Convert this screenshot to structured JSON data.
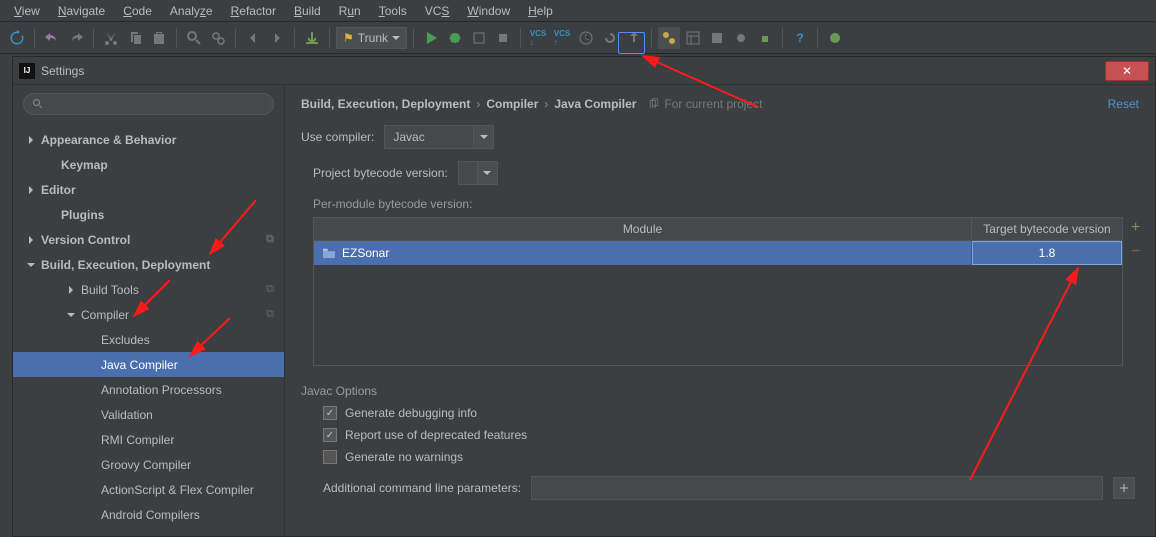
{
  "menu": [
    "View",
    "Navigate",
    "Code",
    "Analyze",
    "Refactor",
    "Build",
    "Run",
    "Tools",
    "VCS",
    "Window",
    "Help"
  ],
  "trunk_label": "Trunk",
  "settings_title": "Settings",
  "sidebar": {
    "items": [
      {
        "label": "Appearance & Behavior",
        "bold": true,
        "arrow": "right",
        "lvl": 0
      },
      {
        "label": "Keymap",
        "bold": true,
        "lvl": 1
      },
      {
        "label": "Editor",
        "bold": true,
        "arrow": "right",
        "lvl": 0
      },
      {
        "label": "Plugins",
        "bold": true,
        "lvl": 1
      },
      {
        "label": "Version Control",
        "bold": true,
        "arrow": "right",
        "lvl": 0,
        "copy": true
      },
      {
        "label": "Build, Execution, Deployment",
        "bold": true,
        "arrow": "down",
        "lvl": 0
      },
      {
        "label": "Build Tools",
        "arrow": "right",
        "lvl": 2,
        "copy": true
      },
      {
        "label": "Compiler",
        "arrow": "down",
        "lvl": 2,
        "copy": true
      },
      {
        "label": "Excludes",
        "lvl": 3
      },
      {
        "label": "Java Compiler",
        "lvl": 3,
        "selected": true
      },
      {
        "label": "Annotation Processors",
        "lvl": 3
      },
      {
        "label": "Validation",
        "lvl": 3
      },
      {
        "label": "RMI Compiler",
        "lvl": 3
      },
      {
        "label": "Groovy Compiler",
        "lvl": 3
      },
      {
        "label": "ActionScript & Flex Compiler",
        "lvl": 3
      },
      {
        "label": "Android Compilers",
        "lvl": 3
      }
    ]
  },
  "breadcrumb": {
    "a": "Build, Execution, Deployment",
    "b": "Compiler",
    "c": "Java Compiler",
    "hint": "For current project",
    "reset": "Reset"
  },
  "compiler": {
    "label": "Use compiler:",
    "value": "Javac"
  },
  "pbv": {
    "label": "Project bytecode version:",
    "value": ""
  },
  "pm_label": "Per-module bytecode version:",
  "table": {
    "h1": "Module",
    "h2": "Target bytecode version",
    "module": "EZSonar",
    "target": "1.8"
  },
  "javac": {
    "title": "Javac Options",
    "c1": "Generate debugging info",
    "c2": "Report use of deprecated features",
    "c3": "Generate no warnings"
  },
  "params_label": "Additional command line parameters:"
}
